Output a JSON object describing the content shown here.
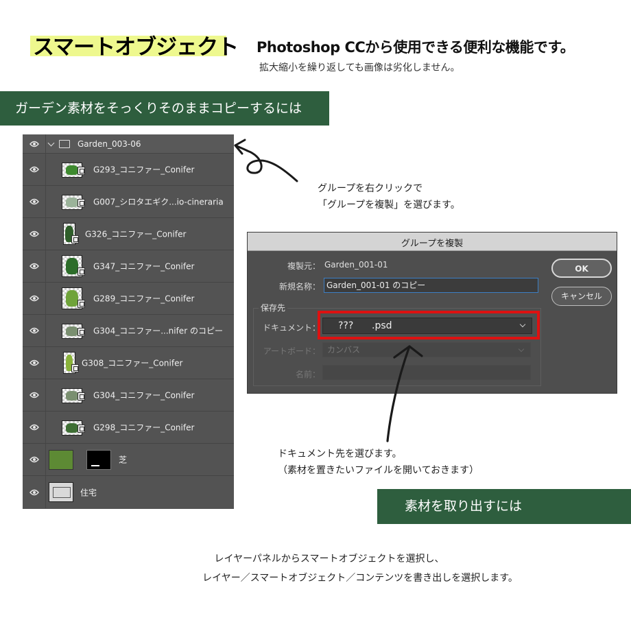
{
  "header": {
    "title": "スマートオブジェクト",
    "tagline": "Photoshop CCから使用できる便利な機能です。",
    "subline": "拡大縮小を繰り返しても画像は劣化しません。"
  },
  "sections": {
    "copy_heading": "ガーデン素材をそっくりそのままコピーするには",
    "extract_heading": "素材を取り出すには"
  },
  "layers_panel": {
    "group_name": "Garden_003-06",
    "layers": [
      "G293_コニファー_Conifer",
      "G007_シロタエギク...io-cineraria",
      "G326_コニファー_Conifer",
      "G347_コニファー_Conifer",
      "G289_コニファー_Conifer",
      "G304_コニファー...nifer のコピー",
      "G308_コニファー_Conifer",
      "G304_コニファー_Conifer",
      "G298_コニファー_Conifer",
      "芝",
      "住宅"
    ]
  },
  "annotations": {
    "step1_line1": "グループを右クリックで",
    "step1_line2": "「グループを複製」を選びます。",
    "step2_line1": "ドキュメント先を選びます。",
    "step2_line2": "（素材を置きたいファイルを開いておきます）",
    "step3_line1": "レイヤーパネルからスマートオブジェクトを選択し、",
    "step3_line2": "レイヤー／スマートオブジェクト／コンテンツを書き出しを選択します。"
  },
  "dialog": {
    "title": "グループを複製",
    "source_label": "複製元：",
    "source_value": "Garden_001-01",
    "new_name_label": "新規名称：",
    "new_name_value": "Garden_001-01 のコピー",
    "destination_label": "保存先",
    "document_label": "ドキュメント：",
    "document_value": "???      .psd",
    "artboard_label": "アートボード：",
    "artboard_value": "カンバス",
    "name_label": "名前：",
    "ok_label": "OK",
    "cancel_label": "キャンセル"
  },
  "colors": {
    "banner": "#2e5e3e",
    "title_highlight": "#eef88e",
    "panel_bg": "#535353",
    "dialog_bg": "#4e4e4e",
    "highlight_box": "#dd1111"
  }
}
